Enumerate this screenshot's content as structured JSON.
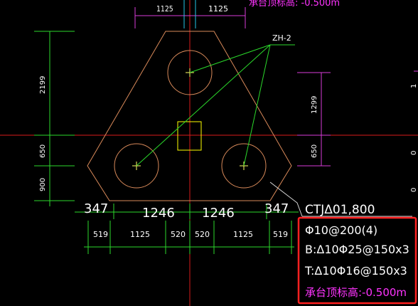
{
  "colors": {
    "background": "#000000",
    "outline": "#d98a5a",
    "dimension": "#2bd92b",
    "axis": "#d81b1b",
    "dim_text": "#ffffff",
    "leader": "#d9d9d9",
    "highlight_box": "#ff2020",
    "elevation_text": "#ff33ff",
    "column": "#ffff00",
    "top_dim": "#d83bd8"
  },
  "top_dims": [
    "1125",
    "1125"
  ],
  "top_label_partial": "承台顶标高: -0.500m",
  "pile_tag": "ZH-2",
  "left_dims": [
    "2199",
    "650",
    "900"
  ],
  "right_dims": [
    "1299",
    "650"
  ],
  "right_edge_dims": [
    "1",
    "0",
    "0"
  ],
  "bottom_row1": [
    "347",
    "1246",
    "1246",
    "347"
  ],
  "bottom_row2": [
    "519",
    "1125",
    "520",
    "520",
    "1125",
    "519"
  ],
  "annotation": {
    "title": "CTJΔ01,800",
    "line1": "Φ10@200(4)",
    "line2": "B:Δ10Φ25@150x3",
    "line3": "T:Δ10Φ16@150x3",
    "line4": "承台顶标高:-0.500m"
  }
}
